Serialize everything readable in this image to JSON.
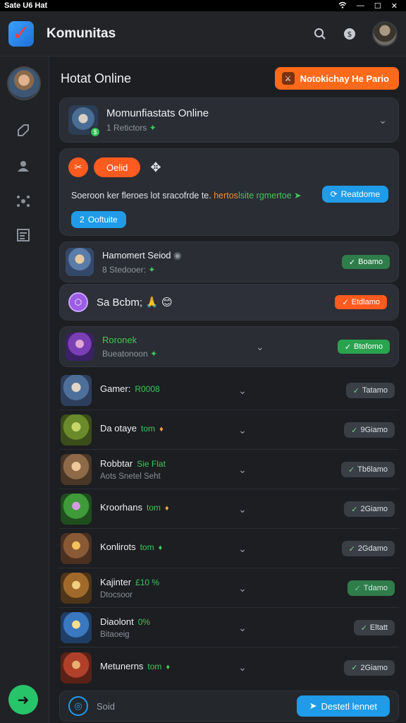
{
  "window": {
    "title": "Sate U6 Hat",
    "controls": [
      "wifi-icon",
      "minimize-icon",
      "maximize-icon",
      "close-icon"
    ]
  },
  "appbar": {
    "title": "Komunitas",
    "icons": [
      "search-icon",
      "notifications-icon",
      "user-avatar"
    ]
  },
  "rail": {
    "icons": [
      "avatar",
      "rocket-icon",
      "profile-icon",
      "network-icon",
      "list-icon"
    ],
    "fab_icon": "compose-icon"
  },
  "section": {
    "title": "Hotat Online",
    "action_label": "Notokichay He Pario"
  },
  "featured": {
    "title": "Momunfiastats Online",
    "subtitle": "1 Retictors"
  },
  "promo": {
    "chip_label": "Oelid",
    "text_prefix": "Soeroon ker fleroes lot sracofrde te. ",
    "text_hl": "hertos",
    "text_gr": "lsite rgmertoe",
    "text_arrow": "➤",
    "cta_label": "Reatdome",
    "sub_label": "Ooftuite"
  },
  "games_top": [
    {
      "name": "Hamomert Seiod",
      "sub": "8 Stedooer:",
      "status": "Boamo",
      "style": "green"
    }
  ],
  "social": {
    "text": "Sa Bcbm; 🙏 😊",
    "status": "Etdlamo"
  },
  "game_highlight": {
    "name": "Roronek",
    "sub": "Bueatonoon",
    "status": "Btofomo"
  },
  "rows": [
    {
      "name": "Gamer:",
      "tag": "R0008",
      "icon": "",
      "sub": "",
      "status": "Tatamo"
    },
    {
      "name": "Da otaye",
      "tag": "tom",
      "icon": "♦",
      "sub": "",
      "status": "9Giamo"
    },
    {
      "name": "Robbtar",
      "tag": "Sie Flat",
      "icon": "",
      "sub": "Aots Snetel Seht",
      "status": "Tb6lamo"
    },
    {
      "name": "Kroorhans",
      "tag": "tom",
      "icon": "♦",
      "sub": "",
      "status": "2Giamo"
    },
    {
      "name": "Konlirots",
      "tag": "tom",
      "icon": "♦",
      "sub": "",
      "status": "2Gdamo"
    },
    {
      "name": "Kajinter",
      "tag": "£10 %",
      "icon": "",
      "sub": "Dtocsoor",
      "status": "Tdamo"
    },
    {
      "name": "Diaolont",
      "tag": "0%",
      "icon": "",
      "sub": "Bitaoeig",
      "status": "Eltatt"
    },
    {
      "name": "Metunerns",
      "tag": "tom",
      "icon": "♦",
      "sub": "",
      "status": "2Giamo"
    }
  ],
  "bottom": {
    "label": "Soid",
    "button_label": "Destetl lennet"
  },
  "colors": {
    "accent_orange": "#ff6a1a",
    "accent_blue": "#1f9be8",
    "accent_green": "#2fbf58",
    "bg": "#1c1e22"
  }
}
